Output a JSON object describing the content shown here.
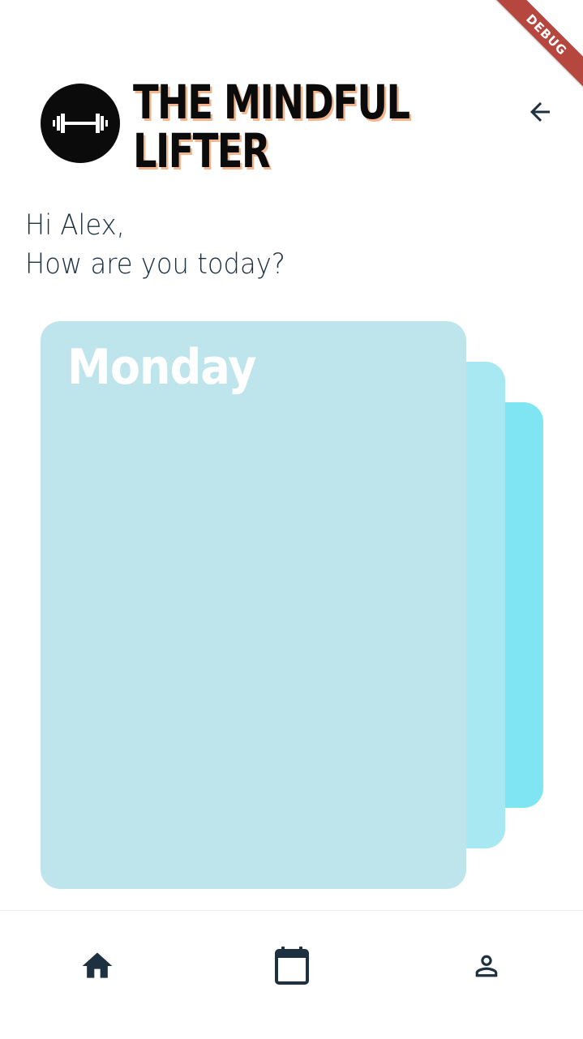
{
  "debug_banner": {
    "label": "DEBUG"
  },
  "header": {
    "brand_line1": "THE MINDFUL",
    "brand_line2": "LIFTER",
    "logo_icon": "dumbbell-icon",
    "back_icon": "arrow-left-icon"
  },
  "greeting": {
    "line1": "Hi Alex,",
    "line2": "How are you today?"
  },
  "day_cards": [
    {
      "label": "Monday"
    }
  ],
  "bottom_nav": {
    "items": [
      {
        "icon": "home-icon"
      },
      {
        "icon": "calendar-icon"
      },
      {
        "icon": "person-icon"
      }
    ]
  },
  "colors": {
    "text_dark": "#1d3140",
    "card_front": "#bfe5ec",
    "card_middle": "#a8e8f2",
    "card_back": "#7fe5f3",
    "brand_shadow": "#f2b58e",
    "debug_ribbon": "#b5473f"
  }
}
